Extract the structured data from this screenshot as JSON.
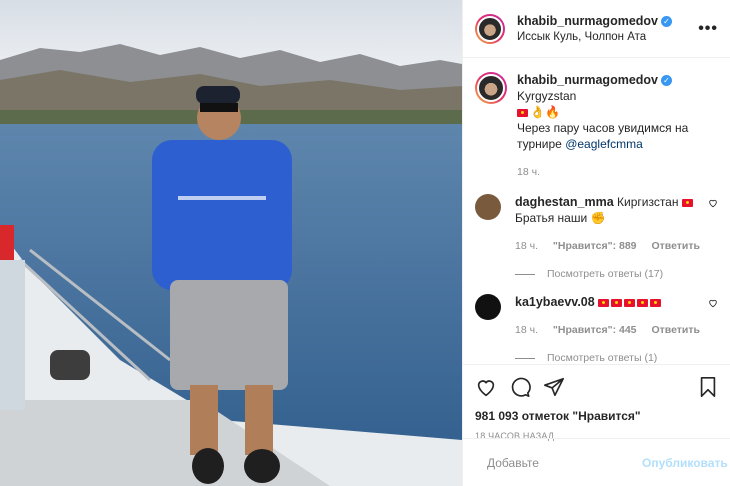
{
  "post": {
    "username": "khabib_nurmagomedov",
    "location": "Иссык Куль, Чолпон Ата",
    "more_icon": "more-dots-icon"
  },
  "caption": {
    "username": "khabib_nurmagomedov",
    "text_lead": "Kyrgyzstan",
    "emoji": "👌🔥",
    "text_body": "Через пару часов увидимся на турнире",
    "mention": "@eaglefcmma",
    "time": "18 ч."
  },
  "comments": [
    {
      "username": "daghestan_mma",
      "text_lead": "Киргизстан",
      "text_body": "Братья наши",
      "emoji": "✊",
      "time": "18 ч.",
      "likes": "\"Нравится\": 889",
      "reply": "Ответить",
      "view_replies": "Посмотреть ответы (17)",
      "avatar_color": "#7a5a3c"
    },
    {
      "username": "ka1ybaevv.08",
      "text_lead": "",
      "text_body": "",
      "emoji": "",
      "time": "18 ч.",
      "likes": "\"Нравится\": 445",
      "reply": "Ответить",
      "view_replies": "Посмотреть ответы (1)",
      "avatar_color": "#111111"
    }
  ],
  "actions": {
    "likes_count": "981 093 отметок \"Нравится\"",
    "posted_ago": "18 ЧАСОВ НАЗАД"
  },
  "add_comment": {
    "placeholder": "Добавьте",
    "publish_label": "Опубликовать"
  },
  "colors": {
    "verified": "#3897f0",
    "link": "#00376b",
    "muted": "#8e8e8e",
    "publish_disabled": "#b2dffc"
  }
}
